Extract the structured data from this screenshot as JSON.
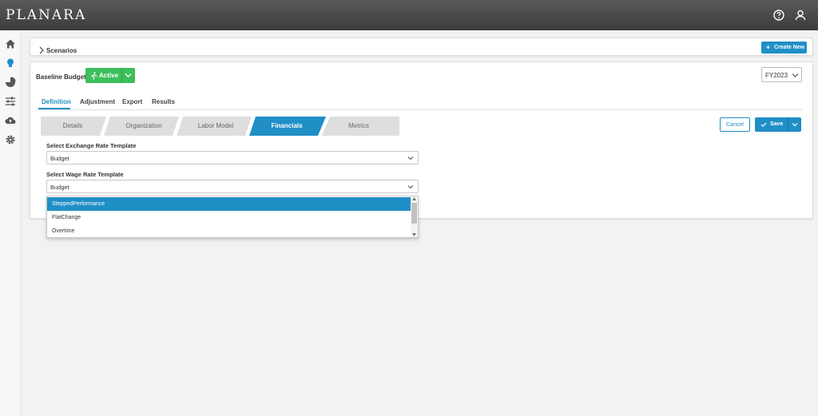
{
  "app": {
    "logo": "PLANARA"
  },
  "topbar": {
    "icons": [
      "help-circle-icon",
      "user-icon"
    ]
  },
  "sidebar": {
    "icons": [
      "home-icon",
      "lightbulb-icon",
      "pie-chart-icon",
      "sliders-icon",
      "cloud-upload-icon",
      "gear-icon"
    ]
  },
  "scenarios": {
    "label": "Scenarios",
    "create_label": "Create New"
  },
  "budget": {
    "name": "Baseline Budget",
    "status_label": "Active",
    "fiscal_year": "FY2023"
  },
  "tabs": [
    {
      "label": "Definition",
      "active": true
    },
    {
      "label": "Adjustment",
      "active": false
    },
    {
      "label": "Export",
      "active": false
    },
    {
      "label": "Results",
      "active": false
    }
  ],
  "steps": [
    {
      "label": "Details",
      "active": false
    },
    {
      "label": "Organization",
      "active": false
    },
    {
      "label": "Labor Model",
      "active": false
    },
    {
      "label": "Financials",
      "active": true
    },
    {
      "label": "Metrics",
      "active": false
    }
  ],
  "actions": {
    "cancel_label": "Cancel",
    "save_label": "Save"
  },
  "form": {
    "exchange": {
      "label": "Select Exchange Rate Template",
      "value": "Budget"
    },
    "wage": {
      "label": "Select Wage Rate Template",
      "value": "Budget"
    }
  },
  "dropdown": {
    "options": [
      "SteppedPerformance",
      "FlatChange",
      "Overtime"
    ],
    "highlighted": "SteppedPerformance"
  },
  "colors": {
    "accent": "#1f8fc6",
    "active_green": "#3dbf5c",
    "topbar": "#4a4a4a"
  }
}
